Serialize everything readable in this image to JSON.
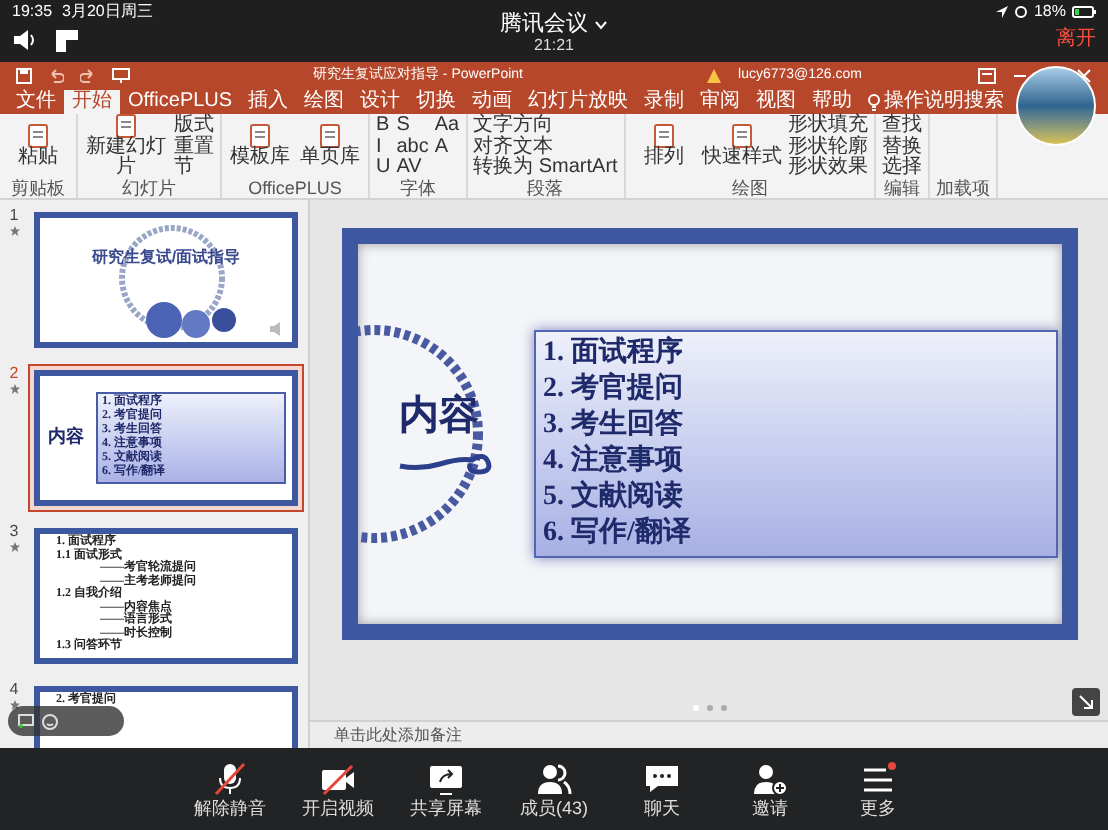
{
  "status_bar": {
    "time": "19:35",
    "date": "3月20日周三",
    "battery": "18%"
  },
  "meeting": {
    "title": "腾讯会议",
    "duration": "21:21",
    "leave": "离开"
  },
  "ppt": {
    "title": "研究生复试应对指导 - PowerPoint",
    "account": "lucy6773@126.com"
  },
  "ribbon_tabs": [
    {
      "label": "文件",
      "selected": false
    },
    {
      "label": "开始",
      "selected": true
    },
    {
      "label": "OfficePLUS",
      "selected": false
    },
    {
      "label": "插入",
      "selected": false
    },
    {
      "label": "绘图",
      "selected": false
    },
    {
      "label": "设计",
      "selected": false
    },
    {
      "label": "切换",
      "selected": false
    },
    {
      "label": "动画",
      "selected": false
    },
    {
      "label": "幻灯片放映",
      "selected": false
    },
    {
      "label": "录制",
      "selected": false
    },
    {
      "label": "审阅",
      "selected": false
    },
    {
      "label": "视图",
      "selected": false
    },
    {
      "label": "帮助",
      "selected": false
    }
  ],
  "ribbon_search": "操作说明搜索",
  "ribbon_groups": [
    {
      "label": "剪贴板",
      "items": [
        {
          "text": "粘贴",
          "kind": "large"
        }
      ]
    },
    {
      "label": "幻灯片",
      "items": [
        {
          "text": "新建幻灯片",
          "kind": "large"
        },
        {
          "text": "版式",
          "kind": "small"
        },
        {
          "text": "重置",
          "kind": "small"
        },
        {
          "text": "节",
          "kind": "small"
        }
      ]
    },
    {
      "label": "OfficePLUS",
      "items": [
        {
          "text": "模板库",
          "kind": "large"
        },
        {
          "text": "单页库",
          "kind": "large"
        }
      ]
    },
    {
      "label": "字体",
      "items": [
        {
          "text": "B",
          "kind": "small"
        },
        {
          "text": "I",
          "kind": "small"
        },
        {
          "text": "U",
          "kind": "small"
        },
        {
          "text": "S",
          "kind": "small"
        },
        {
          "text": "abc",
          "kind": "small"
        },
        {
          "text": "AV",
          "kind": "small"
        },
        {
          "text": "Aa",
          "kind": "small"
        },
        {
          "text": "A",
          "kind": "small"
        }
      ]
    },
    {
      "label": "段落",
      "items": [
        {
          "text": "文字方向",
          "kind": "small"
        },
        {
          "text": "对齐文本",
          "kind": "small"
        },
        {
          "text": "转换为 SmartArt",
          "kind": "small"
        }
      ]
    },
    {
      "label": "绘图",
      "items": [
        {
          "text": "排列",
          "kind": "large"
        },
        {
          "text": "快速样式",
          "kind": "large"
        },
        {
          "text": "形状填充",
          "kind": "small"
        },
        {
          "text": "形状轮廓",
          "kind": "small"
        },
        {
          "text": "形状效果",
          "kind": "small"
        }
      ]
    },
    {
      "label": "编辑",
      "items": [
        {
          "text": "查找",
          "kind": "small"
        },
        {
          "text": "替换",
          "kind": "small"
        },
        {
          "text": "选择",
          "kind": "small"
        }
      ]
    },
    {
      "label": "加载项"
    }
  ],
  "thumbnails": [
    {
      "number": "1",
      "selected": false,
      "kind": "title",
      "title": "研究生复试/面试指导"
    },
    {
      "number": "2",
      "selected": true,
      "kind": "contents",
      "title": "内容",
      "lines": [
        "1. 面试程序",
        "2. 考官提问",
        "3. 考生回答",
        "4. 注意事项",
        "5. 文献阅读",
        "6. 写作/翻译"
      ]
    },
    {
      "number": "3",
      "selected": false,
      "kind": "outline",
      "lines": [
        {
          "text": "1.  面试程序"
        },
        {
          "text": "1.1  面试形式",
          "children": [
            {
              "text": "——考官轮流提问"
            },
            {
              "text": "——主考老师提问"
            }
          ]
        },
        {
          "text": "1.2  自我介绍",
          "children": [
            {
              "text": "——内容焦点"
            },
            {
              "text": "——语言形式"
            },
            {
              "text": "——时长控制"
            }
          ]
        },
        {
          "text": "1.3  问答环节"
        }
      ]
    },
    {
      "number": "4",
      "selected": false,
      "kind": "outline",
      "lines": [
        {
          "text": "2.  考官提问"
        }
      ]
    }
  ],
  "slide": {
    "title": "内容",
    "items": [
      "1. 面试程序",
      "2. 考官提问",
      "3. 考生回答",
      "4. 注意事项",
      "5. 文献阅读",
      "6. 写作/翻译"
    ]
  },
  "notes_placeholder": "单击此处添加备注",
  "toolbar": [
    {
      "label": "解除静音",
      "kind": "mic-off"
    },
    {
      "label": "开启视频",
      "kind": "video-off"
    },
    {
      "label": "共享屏幕",
      "kind": "share"
    },
    {
      "label": "成员(43)",
      "kind": "members"
    },
    {
      "label": "聊天",
      "kind": "chat"
    },
    {
      "label": "邀请",
      "kind": "invite"
    },
    {
      "label": "更多",
      "kind": "more"
    }
  ]
}
